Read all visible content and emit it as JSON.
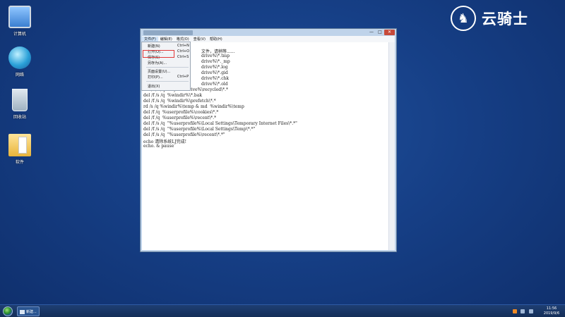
{
  "desktop": {
    "icons": [
      {
        "label": "计算机",
        "icon": "computer-icon"
      },
      {
        "label": "网络",
        "icon": "network-icon"
      },
      {
        "label": "回收站",
        "icon": "recycle-bin-icon"
      },
      {
        "label": "软件",
        "icon": "folder-icon"
      }
    ],
    "logo": {
      "text": "云骑士",
      "icon": "knight-icon"
    }
  },
  "window": {
    "title": "新建文本文档.txt - 记事本",
    "controls": {
      "minimize": "—",
      "maximize": "□",
      "close": "✕"
    },
    "menu": [
      "文件(F)",
      "编辑(E)",
      "格式(O)",
      "查看(V)",
      "帮助(H)"
    ],
    "active_menu": "文件(F)",
    "file_menu": {
      "items": [
        {
          "label": "新建(N)",
          "shortcut": "Ctrl+N"
        },
        {
          "label": "打开(O)...",
          "shortcut": "Ctrl+O"
        },
        {
          "label": "保存(S)",
          "shortcut": "Ctrl+S",
          "highlighted": true
        },
        {
          "label": "另存为(A)...",
          "shortcut": ""
        },
        {
          "label": "页面设置(U)...",
          "shortcut": ""
        },
        {
          "label": "打印(P)...",
          "shortcut": "Ctrl+P"
        },
        {
          "label": "退出(X)",
          "shortcut": ""
        }
      ]
    },
    "lines": [
      "文件，请稍等......",
      "drive%\\*.tmp",
      "drive%\\*._mp",
      "drive%\\*.log",
      "drive%\\*.gid",
      "drive%\\*.chk",
      "drive%\\*.old",
      "del /f /s /q  %systemdrive%\\recycled\\*.*",
      "del /f /s /q  %windir%\\*.bak",
      "del /f /s /q  %windir%\\prefetch\\*.*",
      "rd /s /q %windir%\\temp & md  %windir%\\temp",
      "del /f /q  %userprofile%\\cookies\\*.*",
      "del /f /q  %userprofile%\\recent\\*.*",
      "del /f /s /q  \"%userprofile%\\Local Settings\\Temporary Internet Files\\*.*\"",
      "del /f /s /q  \"%userprofile%\\Local Settings\\Temp\\*.*\"",
      "del /f /s /q  \"%userprofile%\\recent\\*.*\"",
      "echo 清除系统LJ完成!",
      "echo. & pause"
    ]
  },
  "taskbar": {
    "task_label": "新建...",
    "time": "11:56",
    "date": "2019/9/6"
  }
}
